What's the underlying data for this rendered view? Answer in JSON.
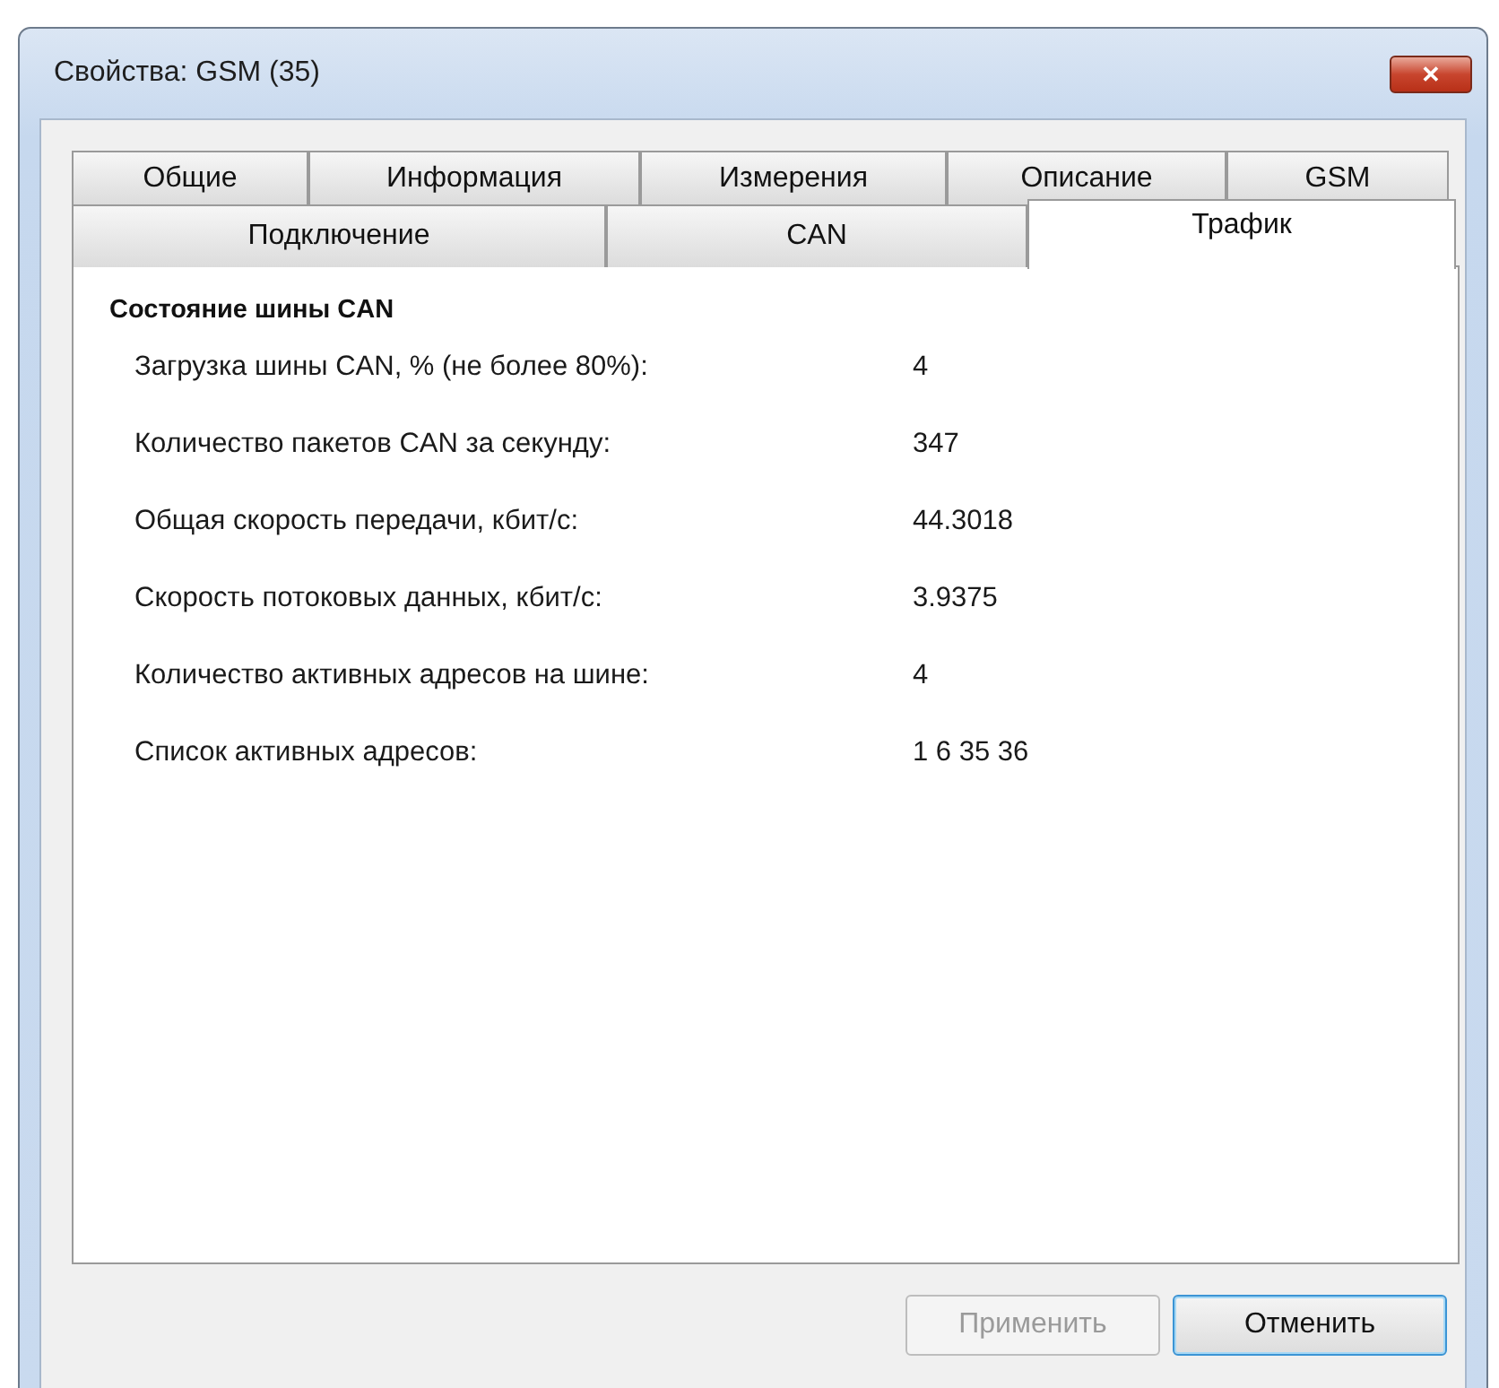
{
  "window": {
    "title": "Свойства: GSM (35)",
    "close": "✕"
  },
  "tab_rows": [
    [
      {
        "label": "Общие",
        "selected": false
      },
      {
        "label": "Информация",
        "selected": false
      },
      {
        "label": "Измерения",
        "selected": false
      },
      {
        "label": "Описание",
        "selected": false
      },
      {
        "label": "GSM",
        "selected": false
      }
    ],
    [
      {
        "label": "Подключение",
        "selected": false
      },
      {
        "label": "CAN",
        "selected": false
      },
      {
        "label": "Трафик",
        "selected": true
      }
    ]
  ],
  "section": {
    "title": "Состояние шины CAN",
    "rows": [
      {
        "label": "Загрузка шины CAN, % (не более 80%):",
        "value": "4"
      },
      {
        "label": "Количество пакетов CAN за секунду:",
        "value": "347"
      },
      {
        "label": "Общая скорость передачи, кбит/с:",
        "value": "44.3018"
      },
      {
        "label": "Скорость потоковых данных, кбит/с:",
        "value": "3.9375"
      },
      {
        "label": "Количество активных адресов на шине:",
        "value": "4"
      },
      {
        "label": "Список активных адресов:",
        "value": "1 6 35 36"
      }
    ]
  },
  "buttons": [
    {
      "label": "Применить",
      "disabled": true,
      "default": false
    },
    {
      "label": "Отменить",
      "disabled": false,
      "default": true
    }
  ]
}
